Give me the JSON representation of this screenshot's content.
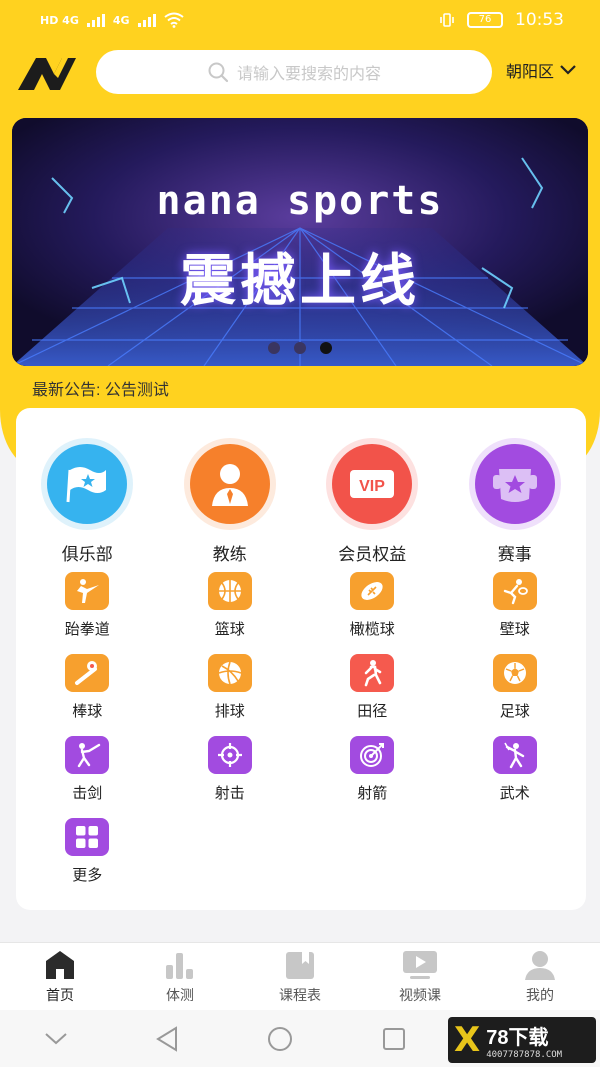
{
  "status": {
    "left_1": "HD 4G",
    "left_2": "4G",
    "battery": "76",
    "time": "10:53"
  },
  "header": {
    "search_placeholder": "请输入要搜索的内容",
    "district": "朝阳区"
  },
  "banner": {
    "title": "nana sports",
    "subtitle": "震撼上线"
  },
  "notice": "最新公告: 公告测试",
  "featured": [
    {
      "label": "俱乐部",
      "icon": "flag-star-icon"
    },
    {
      "label": "教练",
      "icon": "coach-icon"
    },
    {
      "label": "会员权益",
      "icon": "vip-icon"
    },
    {
      "label": "赛事",
      "icon": "event-icon"
    }
  ],
  "sports": [
    {
      "label": "跆拳道",
      "icon": "taekwondo-icon"
    },
    {
      "label": "篮球",
      "icon": "basketball-icon"
    },
    {
      "label": "橄榄球",
      "icon": "rugby-icon"
    },
    {
      "label": "壁球",
      "icon": "squash-icon"
    },
    {
      "label": "棒球",
      "icon": "baseball-icon"
    },
    {
      "label": "排球",
      "icon": "volleyball-icon"
    },
    {
      "label": "田径",
      "icon": "track-icon"
    },
    {
      "label": "足球",
      "icon": "football-icon"
    },
    {
      "label": "击剑",
      "icon": "fencing-icon"
    },
    {
      "label": "射击",
      "icon": "shooting-icon"
    },
    {
      "label": "射箭",
      "icon": "archery-icon"
    },
    {
      "label": "武术",
      "icon": "wushu-icon"
    },
    {
      "label": "更多",
      "icon": "more-grid-icon"
    }
  ],
  "tabs": [
    {
      "label": "首页",
      "icon": "home-icon"
    },
    {
      "label": "体测",
      "icon": "chart-icon"
    },
    {
      "label": "课程表",
      "icon": "schedule-icon"
    },
    {
      "label": "视频课",
      "icon": "video-icon"
    },
    {
      "label": "我的",
      "icon": "profile-icon"
    }
  ],
  "watermark": {
    "main": "78下载",
    "url": "4007787878.COM"
  },
  "colors": {
    "brand_yellow": "#ffd21f",
    "sport_orange": "#f7a02e",
    "sport_red": "#f55a4e",
    "sport_purple": "#a24be0"
  }
}
